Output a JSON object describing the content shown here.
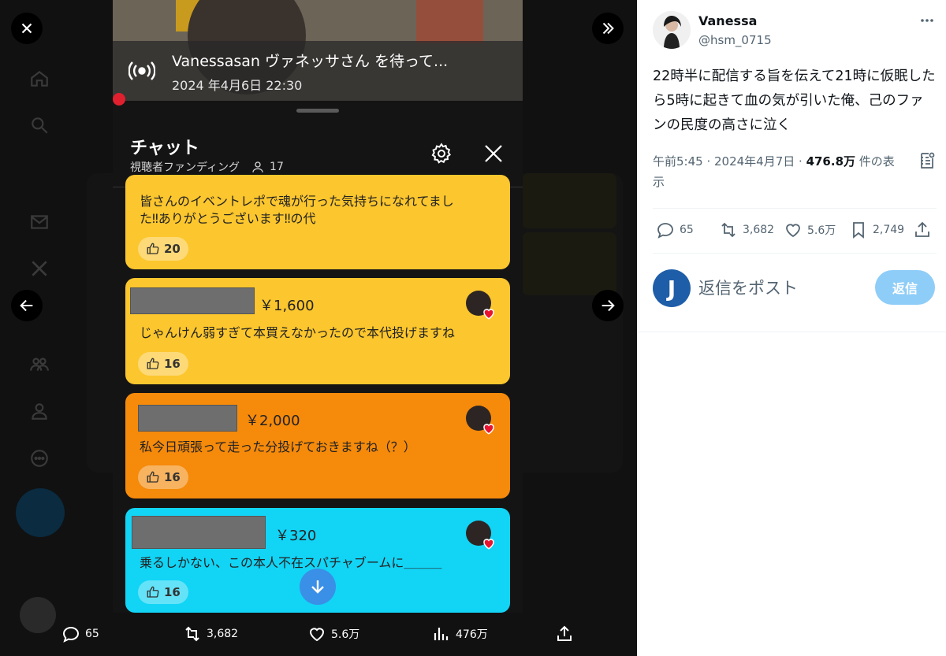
{
  "stream": {
    "title": "Vanessasan ヴァネッサさん を待って...",
    "date": "2024 年4月6日 22:30"
  },
  "chat": {
    "title": "チャット",
    "subtitle": "視聴者ファンディング",
    "viewer_count": "17"
  },
  "messages": [
    {
      "text_line1": "皆さんのイベントレポで魂が行った気持ちになれてまし",
      "text_line2": "た‼ありがとうございます‼の代",
      "likes": "20"
    },
    {
      "amount": "￥1,600",
      "text": "じゃんけん弱すぎて本買えなかったので本代投げますね",
      "likes": "16"
    },
    {
      "amount": "￥2,000",
      "text": "私今日頑張って走った分投げておきますね（？）",
      "likes": "16"
    },
    {
      "amount": "￥320",
      "text": "乗るしかない、この本人不在スパチャブームに＿＿＿",
      "likes": "16"
    }
  ],
  "viewer_bar": {
    "replies": "65",
    "reposts": "3,682",
    "likes": "5.6万",
    "views": "476万"
  },
  "post": {
    "author_name": "Vanessa",
    "author_handle": "@hsm_0715",
    "text": "22時半に配信する旨を伝えて21時に仮眠したら5時に起きて血の気が引いた俺、己のファンの民度の高さに泣く",
    "timestamp": "午前5:45 · 2024年4月7日 · ",
    "views_count": "476.8万",
    "views_suffix": " 件の表示",
    "replies": "65",
    "reposts": "3,682",
    "likes": "5.6万",
    "bookmarks": "2,749"
  },
  "reply": {
    "avatar_letter": "J",
    "placeholder": "返信をポスト",
    "button_label": "返信"
  },
  "colors": {
    "yellow_card": "#fcc62e",
    "orange_card": "#f58a0b",
    "cyan_card": "#12d4f5",
    "accent_blue": "#1d9bf0"
  },
  "icons": [
    "close-icon",
    "expand-icon",
    "arrow-left-icon",
    "arrow-right-icon",
    "live-broadcast-icon",
    "gear-icon",
    "person-icon",
    "thumbs-up-icon",
    "heart-icon",
    "arrow-down-icon",
    "reply-icon",
    "repost-icon",
    "like-icon",
    "views-icon",
    "share-icon",
    "bookmark-icon",
    "more-icon",
    "grok-icon"
  ]
}
